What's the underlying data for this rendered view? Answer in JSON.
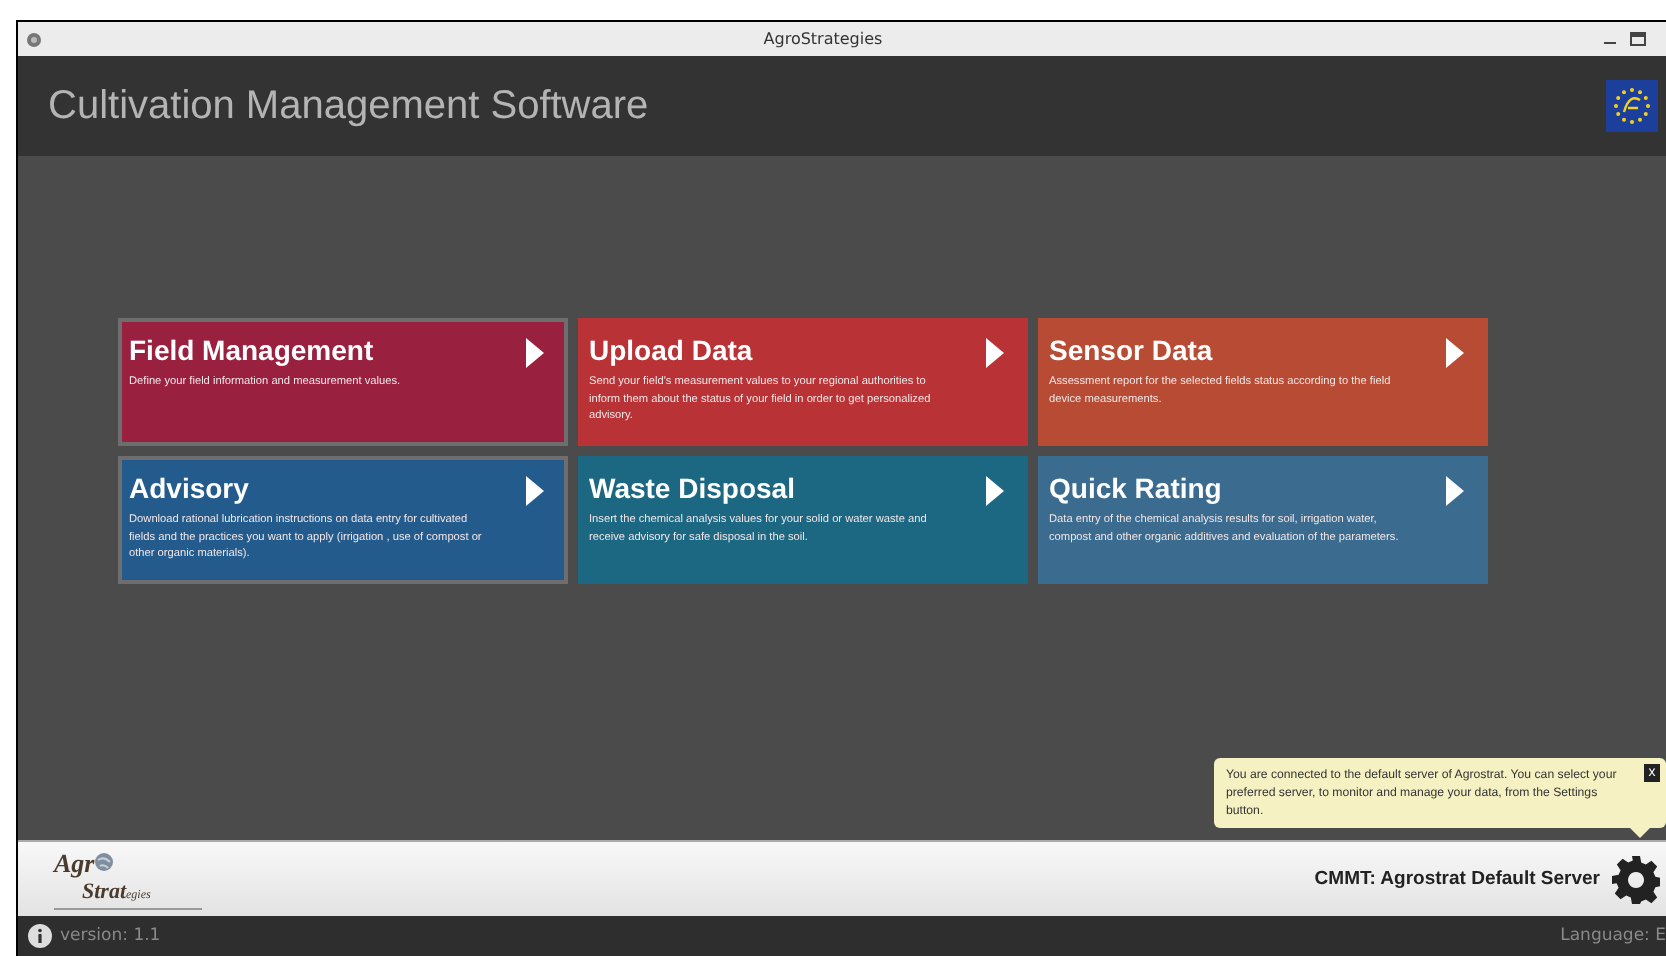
{
  "window": {
    "title": "AgroStrategies"
  },
  "header": {
    "title": "Cultivation Management Software"
  },
  "tiles": [
    {
      "title": "Field Management",
      "description": "Define your field information and measurement values.",
      "color": "#9a2040",
      "outlined": true
    },
    {
      "title": "Upload Data",
      "description": "Send your field's measurement values to your regional authorities to inform them about the status of your field in order to get personalized advisory.",
      "color": "#b83236",
      "outlined": false
    },
    {
      "title": "Sensor Data",
      "description": "Assessment report for the selected fields status according to the field device measurements.",
      "color": "#b84b33",
      "outlined": false
    },
    {
      "title": "Advisory",
      "description": "Download rational lubrication instructions on data entry for cultivated fields and the practices you want to apply (irrigation , use of compost or other organic materials).",
      "color": "#245b8d",
      "outlined": true
    },
    {
      "title": "Waste Disposal",
      "description": "Insert the chemical analysis values for your solid or water waste and receive advisory for safe disposal in the soil.",
      "color": "#1c6782",
      "outlined": false
    },
    {
      "title": "Quick Rating",
      "description": "Data entry of the chemical analysis results for soil, irrigation water, compost and other organic additives and evaluation of the parameters.",
      "color": "#3b6b8f",
      "outlined": false
    }
  ],
  "tooltip": {
    "text": "You are connected to the default server of Agrostrat. You can select your preferred server, to monitor and manage your data, from the Settings button.",
    "close": "x"
  },
  "footer": {
    "logo": {
      "line1": "Agr",
      "line2": "Strat",
      "suffix": "egies"
    },
    "server": "CMMT: Agrostrat Default Server"
  },
  "status_bar": {
    "version": "version: 1.1",
    "language": "Language: E"
  }
}
